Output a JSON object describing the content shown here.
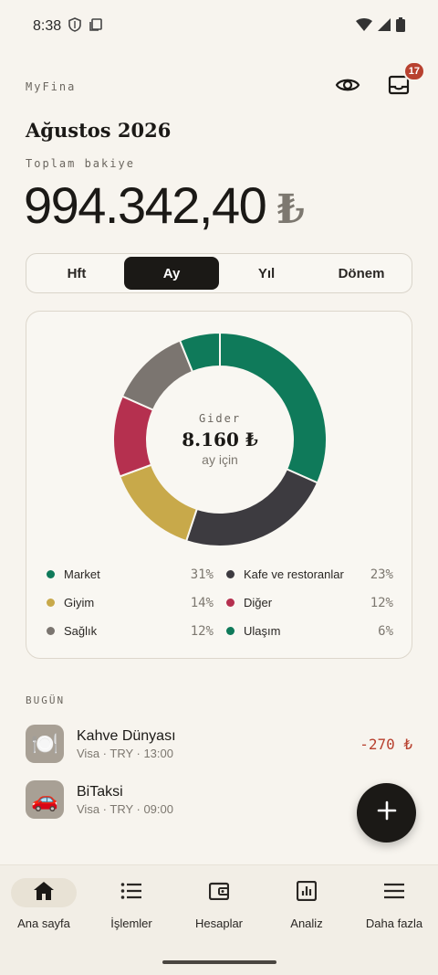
{
  "status_bar": {
    "time": "8:38"
  },
  "header": {
    "brand": "MyFina",
    "notification_count": "17"
  },
  "month_title": "Ağustos 2026",
  "balance": {
    "label": "Toplam bakiye",
    "amount": "994.342,40",
    "currency": "₺"
  },
  "period_tabs": [
    {
      "label": "Hft",
      "active": false
    },
    {
      "label": "Ay",
      "active": true
    },
    {
      "label": "Yıl",
      "active": false
    },
    {
      "label": "Dönem",
      "active": false
    }
  ],
  "expense_card": {
    "center_label": "Gider",
    "center_value": "8.160 ₺",
    "center_sub": "ay için"
  },
  "chart_data": {
    "type": "pie",
    "categories": [
      "Market",
      "Kafe ve restoranlar",
      "Giyim",
      "Diğer",
      "Sağlık",
      "Ulaşım"
    ],
    "values": [
      31,
      23,
      14,
      12,
      12,
      6
    ],
    "labels": [
      "31%",
      "23%",
      "14%",
      "12%",
      "12%",
      "6%"
    ],
    "colors": [
      "#0f7a5a",
      "#3d3b40",
      "#c8a94a",
      "#b5304f",
      "#7b7570",
      "#0f7a5a"
    ]
  },
  "section_today": "BUGÜN",
  "transactions": [
    {
      "title": "Kahve Dünyası",
      "meta": "Visa · TRY · 13:00",
      "amount": "-270 ₺",
      "icon": "🍽️",
      "icon_bg": "#a8a095"
    },
    {
      "title": "BiTaksi",
      "meta": "Visa · TRY · 09:00",
      "amount": "",
      "icon": "🚗",
      "icon_bg": "#a8a095"
    }
  ],
  "bottom_nav": [
    {
      "label": "Ana sayfa",
      "icon": "home-icon",
      "active": true
    },
    {
      "label": "İşlemler",
      "icon": "list-icon",
      "active": false
    },
    {
      "label": "Hesaplar",
      "icon": "wallet-icon",
      "active": false
    },
    {
      "label": "Analiz",
      "icon": "chart-icon",
      "active": false
    },
    {
      "label": "Daha fazla",
      "icon": "menu-icon",
      "active": false
    }
  ]
}
